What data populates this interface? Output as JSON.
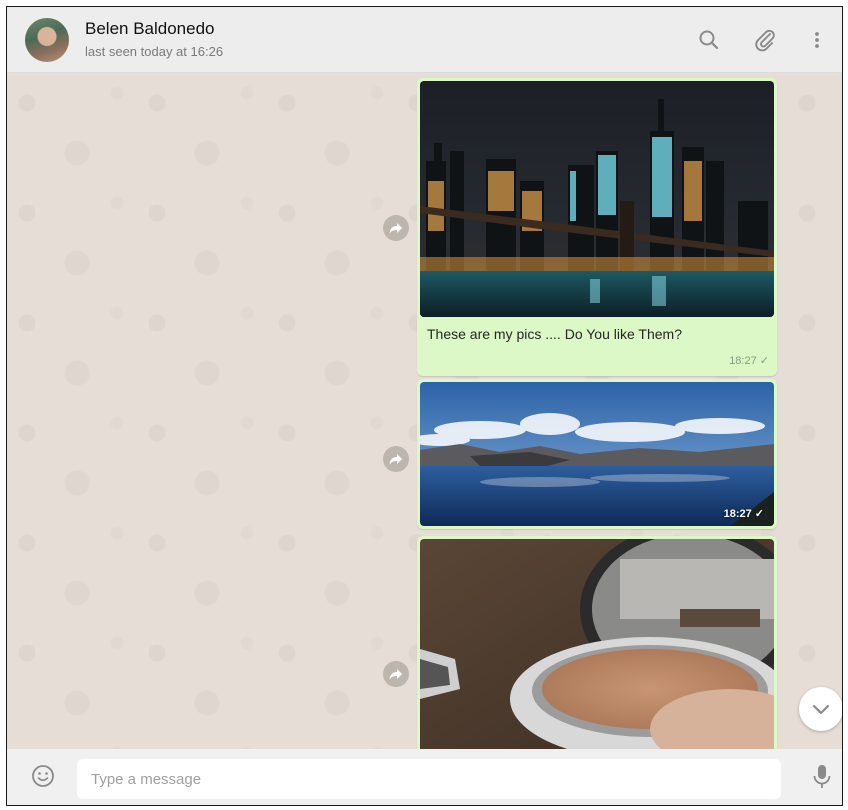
{
  "header": {
    "contact_name": "Belen Baldonedo",
    "status": "last seen today at 16:26",
    "icons": [
      "search-icon",
      "attach-icon",
      "menu-icon"
    ]
  },
  "messages": [
    {
      "image": "city-skyline-night-photo",
      "caption": "These are my pics .... Do You like Them?",
      "time": "18:27 ✓"
    },
    {
      "image": "lake-landscape-photo",
      "time": "18:27 ✓"
    },
    {
      "image": "makeup-compact-photo"
    }
  ],
  "composer": {
    "placeholder": "Type a message",
    "value": ""
  },
  "colors": {
    "header_bg": "#ededed",
    "chat_bg": "#e6ded6",
    "outgoing_bubble": "#dcf8c6",
    "footer_bg": "#f0f0f0"
  }
}
